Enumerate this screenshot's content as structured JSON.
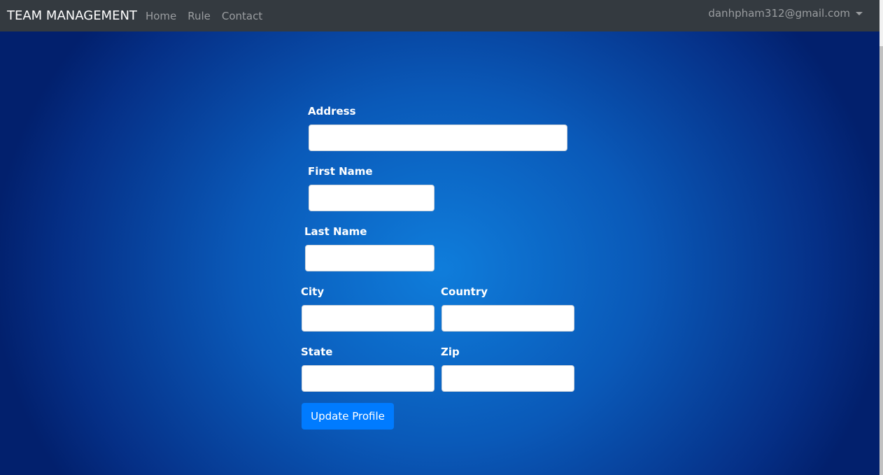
{
  "nav": {
    "brand": "TEAM MANAGEMENT",
    "links": [
      "Home",
      "Rule",
      "Contact"
    ],
    "user": "danhpham312@gmail.com"
  },
  "form": {
    "address": "Address",
    "first_name": "First Name",
    "last_name": "Last Name",
    "city": "City",
    "country": "Country",
    "state": "State",
    "zip": "Zip",
    "submit": "Update Profile"
  }
}
